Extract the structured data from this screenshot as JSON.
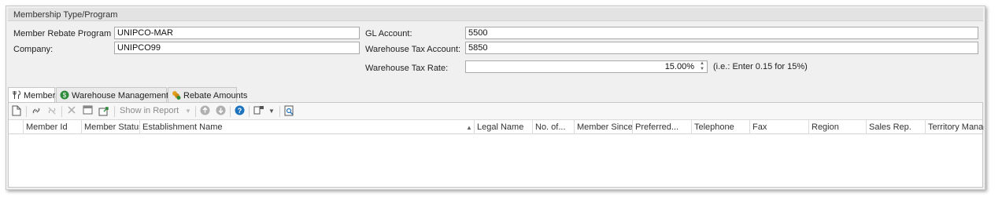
{
  "group": {
    "title": "Membership Type/Program"
  },
  "form": {
    "member_rebate_program_name_label": "Member Rebate Program Name:",
    "member_rebate_program_name_value": "UNIPCO-MAR",
    "company_label": "Company:",
    "company_value": "UNIPCO99",
    "gl_account_label": "GL Account:",
    "gl_account_value": "5500",
    "warehouse_tax_account_label": "Warehouse Tax Account:",
    "warehouse_tax_account_value": "5850",
    "warehouse_tax_rate_label": "Warehouse Tax Rate:",
    "warehouse_tax_rate_value": "15.00%",
    "warehouse_tax_rate_hint": "(i.e.: Enter 0.15 for 15%)"
  },
  "tabs": [
    {
      "label": "Members",
      "icon": "fork-knife-icon",
      "active": true
    },
    {
      "label": "Warehouse Management Fees",
      "icon": "dollar-circle-icon",
      "active": false
    },
    {
      "label": "Rebate Amounts",
      "icon": "coins-icon",
      "active": false
    }
  ],
  "toolbar": {
    "show_in_report_label": "Show in Report",
    "icons": [
      "new-icon",
      "link-icon",
      "unlink-icon",
      "delete-icon",
      "window-icon",
      "export-icon",
      "move-up-icon",
      "move-down-icon",
      "help-icon",
      "layout-icon",
      "preview-icon"
    ]
  },
  "grid": {
    "columns": [
      "Member Id",
      "Member Status...",
      "Establishment Name",
      "Legal Name",
      "No. of...",
      "Member Since",
      "Preferred...",
      "Telephone",
      "Fax",
      "Region",
      "Sales Rep.",
      "Territory Manager"
    ],
    "rows": []
  },
  "colors": {
    "panel_bg": "#f0f0f0",
    "border": "#c9c9c9",
    "accent_blue": "#1e73be",
    "accent_green": "#2e8b3a"
  }
}
